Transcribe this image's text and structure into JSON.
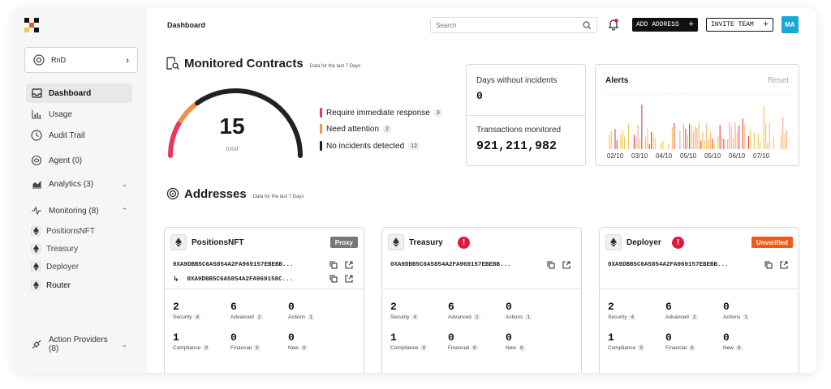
{
  "sidebar": {
    "org_name": "RnD",
    "nav": [
      {
        "label": "Dashboard"
      },
      {
        "label": "Usage"
      },
      {
        "label": "Audit Trail"
      },
      {
        "label": "Agent (0)"
      },
      {
        "label": "Analytics (3)"
      },
      {
        "label": "Monitoring (8)"
      }
    ],
    "monitoring_items": [
      {
        "label": "PositionsNFT"
      },
      {
        "label": "Treasury"
      },
      {
        "label": "Deployer"
      },
      {
        "label": "Router"
      }
    ],
    "action_providers": "Action Providers (8)"
  },
  "header": {
    "title": "Dashboard",
    "search_placeholder": "Search",
    "add_address": "ADD ADDRESS",
    "invite_team": "INVITE TEAM",
    "avatar_initials": "MA",
    "accent": "#14a9d7"
  },
  "monitored": {
    "title": "Monitored Contracts",
    "subtitle": "Data for the last 7 Days",
    "total": "15",
    "total_label": "total",
    "gauge_fraction": 1.0,
    "legend": [
      {
        "label": "Require immediate response",
        "count": "3",
        "color": "#e8395a"
      },
      {
        "label": "Need attention",
        "count": "2",
        "color": "#f0904a"
      },
      {
        "label": "No incidents detected",
        "count": "12",
        "color": "#222222"
      }
    ]
  },
  "stats": {
    "days_label": "Days without incidents",
    "days_value": "0",
    "tx_label": "Transactions monitored",
    "tx_value": "921,211,982"
  },
  "alerts": {
    "title": "Alerts",
    "reset": "Reset",
    "ticks": [
      "02/10",
      "03/10",
      "04/10",
      "05/10",
      "05/10",
      "06/10",
      "07/10"
    ],
    "colors": {
      "red": "#e8395a",
      "yellow": "#f3c74a",
      "peach": "#f2a886"
    }
  },
  "addresses": {
    "title": "Addresses",
    "subtitle": "Data for the last 7 Days",
    "cards": [
      {
        "name": "PositionsNFT",
        "tag": "Proxy",
        "tag_color": "#777777",
        "warning": "",
        "address": "0XA9DBB5C6A5854A2FA969157EBEBB...",
        "implementation": "0XA9DBB5C6A5854A2FA969158C...",
        "metrics": [
          {
            "value": "2",
            "label": "Security",
            "count": "4"
          },
          {
            "value": "6",
            "label": "Advanced",
            "count": "2"
          },
          {
            "value": "0",
            "label": "Actions",
            "count": "1"
          },
          {
            "value": "1",
            "label": "Compliance",
            "count": "0"
          },
          {
            "value": "0",
            "label": "Financial",
            "count": "0"
          },
          {
            "value": "0",
            "label": "New",
            "count": "0"
          }
        ]
      },
      {
        "name": "Treasury",
        "tag": "",
        "warning": "!",
        "address": "0XA9DBB5C6A5854A2FA969157EBEBB...",
        "metrics": [
          {
            "value": "2",
            "label": "Security",
            "count": "4"
          },
          {
            "value": "6",
            "label": "Advanced",
            "count": "2"
          },
          {
            "value": "0",
            "label": "Actions",
            "count": "1"
          },
          {
            "value": "1",
            "label": "Compliance",
            "count": "0"
          },
          {
            "value": "0",
            "label": "Financial",
            "count": "0"
          },
          {
            "value": "0",
            "label": "New",
            "count": "0"
          }
        ]
      },
      {
        "name": "Deployer",
        "tag": "Unverified",
        "tag_color": "#f05a1a",
        "warning": "!",
        "address": "0XA9DBB5C6A5854A2FA969157EBEBB...",
        "metrics": [
          {
            "value": "2",
            "label": "Security",
            "count": "4"
          },
          {
            "value": "6",
            "label": "Advanced",
            "count": "2"
          },
          {
            "value": "0",
            "label": "Actions",
            "count": "1"
          },
          {
            "value": "1",
            "label": "Compliance",
            "count": "0"
          },
          {
            "value": "0",
            "label": "Financial",
            "count": "0"
          },
          {
            "value": "0",
            "label": "New",
            "count": "0"
          }
        ]
      }
    ]
  }
}
